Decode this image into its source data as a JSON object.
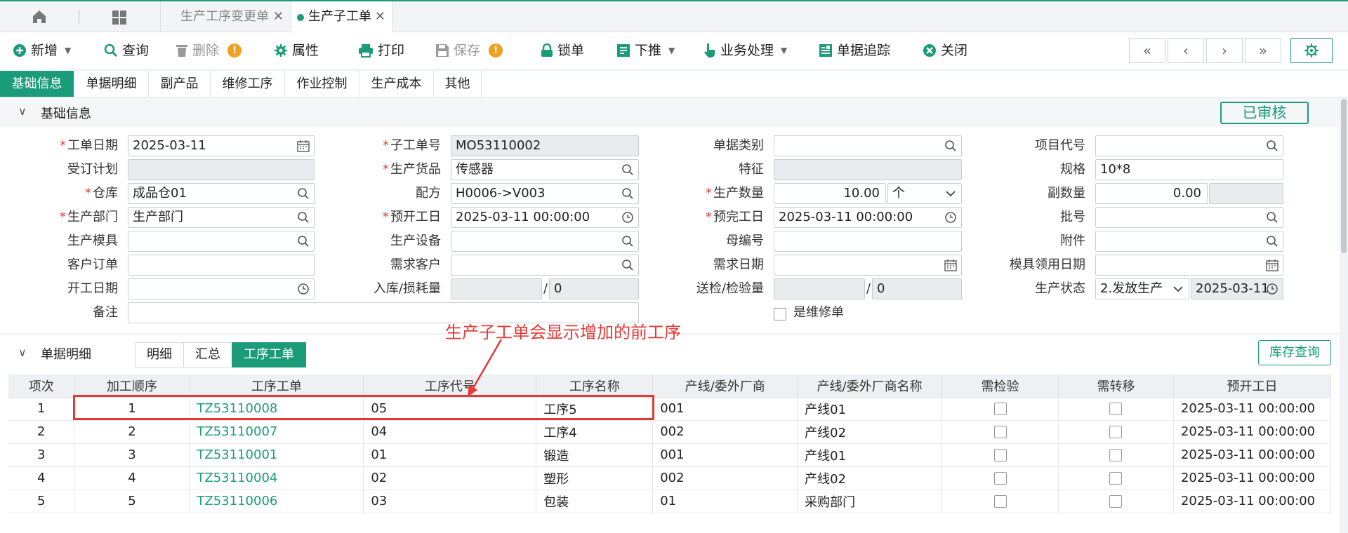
{
  "tabs": [
    {
      "label": "生产工序变更单"
    },
    {
      "label": "生产子工单"
    }
  ],
  "toolbar": {
    "new": "新增",
    "query": "查询",
    "delete": "删除",
    "props": "属性",
    "print": "打印",
    "save": "保存",
    "lock": "锁单",
    "push": "下推",
    "business": "业务处理",
    "trace": "单据追踪",
    "close": "关闭"
  },
  "subtabs": [
    "基础信息",
    "单据明细",
    "副产品",
    "维修工序",
    "作业控制",
    "生产成本",
    "其他"
  ],
  "basic": {
    "section_title": "基础信息",
    "status_stamp": "已审核",
    "fields": {
      "work_date": {
        "label": "工单日期",
        "value": "2025-03-11"
      },
      "order_plan": {
        "label": "受订计划",
        "value": ""
      },
      "warehouse": {
        "label": "仓库",
        "value": "成品仓01"
      },
      "dept": {
        "label": "生产部门",
        "value": "生产部门"
      },
      "mold": {
        "label": "生产模具",
        "value": ""
      },
      "customer_order": {
        "label": "客户订单",
        "value": ""
      },
      "start_date": {
        "label": "开工日期",
        "value": ""
      },
      "remark": {
        "label": "备注",
        "value": ""
      },
      "sub_no": {
        "label": "子工单号",
        "value": "MO53110002"
      },
      "goods": {
        "label": "生产货品",
        "value": "传感器"
      },
      "formula": {
        "label": "配方",
        "value": "H0006->V003"
      },
      "plan_start": {
        "label": "预开工日",
        "value": "2025-03-11 00:00:00"
      },
      "equipment": {
        "label": "生产设备",
        "value": ""
      },
      "demand_customer": {
        "label": "需求客户",
        "value": ""
      },
      "inbound_loss": {
        "label": "入库/损耗量",
        "value1": "",
        "value2": "0"
      },
      "doc_type": {
        "label": "单据类别",
        "value": ""
      },
      "feature": {
        "label": "特征",
        "value": ""
      },
      "qty": {
        "label": "生产数量",
        "value": "10.00",
        "unit": "个"
      },
      "plan_end": {
        "label": "预完工日",
        "value": "2025-03-11 00:00:00"
      },
      "parent_no": {
        "label": "母编号",
        "value": ""
      },
      "demand_date": {
        "label": "需求日期",
        "value": ""
      },
      "inspect": {
        "label": "送检/检验量",
        "value1": "",
        "value2": "0"
      },
      "is_repair": {
        "label": "是维修单",
        "checked": false
      },
      "project_code": {
        "label": "项目代号",
        "value": ""
      },
      "spec": {
        "label": "规格",
        "value": "10*8"
      },
      "sub_qty": {
        "label": "副数量",
        "value": "0.00",
        "value2": ""
      },
      "batch": {
        "label": "批号",
        "value": ""
      },
      "attachment": {
        "label": "附件",
        "value": ""
      },
      "mold_date": {
        "label": "模具领用日期",
        "value": ""
      },
      "prod_status": {
        "label": "生产状态",
        "value": "2.发放生产",
        "date": "2025-03-11"
      }
    }
  },
  "annotation": "生产子工单会显示增加的前工序",
  "detail": {
    "section_title": "单据明细",
    "tabs": [
      "明细",
      "汇总",
      "工序工单"
    ],
    "stock_button": "库存查询",
    "columns": [
      "项次",
      "加工顺序",
      "工序工单",
      "工序代号",
      "工序名称",
      "产线/委外厂商",
      "产线/委外厂商名称",
      "需检验",
      "需转移",
      "预开工日"
    ],
    "rows": [
      {
        "idx": "1",
        "seq": "1",
        "order": "TZ53110008",
        "code": "05",
        "name": "工序5",
        "line": "001",
        "line_name": "产线01",
        "start": "2025-03-11 00:00:00"
      },
      {
        "idx": "2",
        "seq": "2",
        "order": "TZ53110007",
        "code": "04",
        "name": "工序4",
        "line": "002",
        "line_name": "产线02",
        "start": "2025-03-11 00:00:00"
      },
      {
        "idx": "3",
        "seq": "3",
        "order": "TZ53110001",
        "code": "01",
        "name": "锻造",
        "line": "001",
        "line_name": "产线01",
        "start": "2025-03-11 00:00:00"
      },
      {
        "idx": "4",
        "seq": "4",
        "order": "TZ53110004",
        "code": "02",
        "name": "塑形",
        "line": "002",
        "line_name": "产线02",
        "start": "2025-03-11 00:00:00"
      },
      {
        "idx": "5",
        "seq": "5",
        "order": "TZ53110006",
        "code": "03",
        "name": "包装",
        "line": "01",
        "line_name": "采购部门",
        "start": "2025-03-11 00:00:00"
      }
    ]
  },
  "colors": {
    "accent": "#1a9c7a",
    "annotation": "#e53935",
    "warn": "#f0a020"
  }
}
